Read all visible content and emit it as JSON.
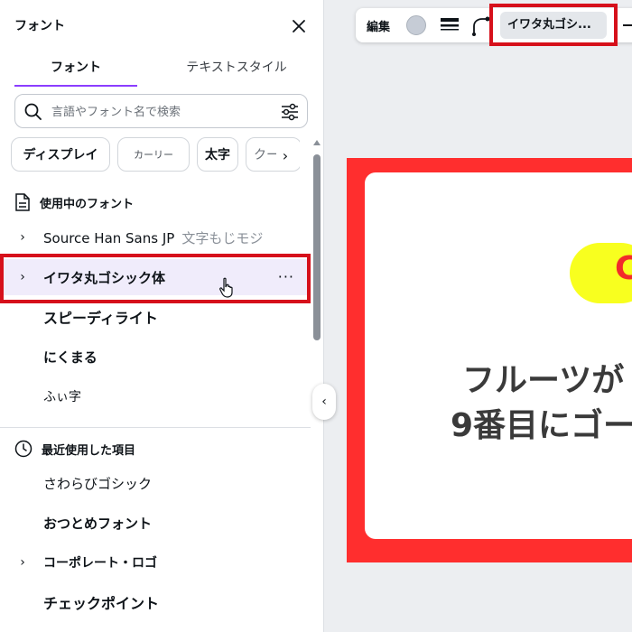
{
  "panel": {
    "title": "フォント",
    "tabs": [
      {
        "label": "フォント",
        "active": true
      },
      {
        "label": "テキストスタイル",
        "active": false
      }
    ],
    "search": {
      "value": "",
      "placeholder": "言語やフォント名で検索"
    },
    "chips": [
      {
        "label": "ディスプレイ"
      },
      {
        "label": "カーリー"
      },
      {
        "label": "太字"
      },
      {
        "label": "クール"
      }
    ],
    "sections": [
      {
        "title": "使用中のフォント",
        "icon": "document-icon",
        "items": [
          {
            "name": "Source Han Sans JP",
            "sample": "文字もじモジ",
            "expandable": true
          },
          {
            "name": "イワタ丸ゴシック体",
            "expandable": true,
            "selected": true
          }
        ]
      },
      {
        "title": "",
        "items": [
          {
            "name": "スピーディライト"
          },
          {
            "name": "にくまる"
          },
          {
            "name": "ふぃ字"
          }
        ]
      },
      {
        "title": "最近使用した項目",
        "icon": "clock-icon",
        "items": [
          {
            "name": "さわらびゴシック"
          },
          {
            "name": "おつとめフォント"
          },
          {
            "name": "コーポレート・ロゴ",
            "expandable": true
          },
          {
            "name": "チェックポイント"
          }
        ]
      }
    ]
  },
  "toolbar": {
    "edit_label": "編集",
    "font_label": "イワタ丸ゴシ...",
    "color_swatch": "#c6ccd6"
  },
  "design": {
    "pill_text": "C",
    "line1": "フルーツが",
    "line2": "9番目にゴー",
    "frame_color": "#ff2e2e",
    "pill_color": "#f8ff1f"
  },
  "highlight_color": "#d6101b",
  "accent_color": "#8b3dff"
}
